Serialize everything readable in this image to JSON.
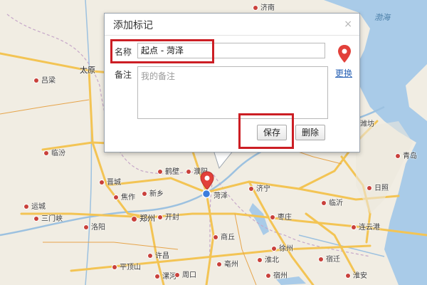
{
  "map": {
    "sea_label": "渤海",
    "cities": [
      {
        "name": "吕梁",
        "major": false
      },
      {
        "name": "太原",
        "major": true
      },
      {
        "name": "临汾",
        "major": false
      },
      {
        "name": "晋城",
        "major": false
      },
      {
        "name": "运城",
        "major": false
      },
      {
        "name": "三门峡",
        "major": false
      },
      {
        "name": "洛阳",
        "major": false
      },
      {
        "name": "郑州",
        "major": true
      },
      {
        "name": "开封",
        "major": false
      },
      {
        "name": "焦作",
        "major": false
      },
      {
        "name": "新乡",
        "major": false
      },
      {
        "name": "鹤壁",
        "major": false
      },
      {
        "name": "濮阳",
        "major": false
      },
      {
        "name": "平顶山",
        "major": false
      },
      {
        "name": "许昌",
        "major": false
      },
      {
        "name": "漯河",
        "major": false
      },
      {
        "name": "周口",
        "major": false
      },
      {
        "name": "商丘",
        "major": false
      },
      {
        "name": "亳州",
        "major": false
      },
      {
        "name": "淮北",
        "major": false
      },
      {
        "name": "宿州",
        "major": false
      },
      {
        "name": "菏泽",
        "major": false
      },
      {
        "name": "济宁",
        "major": false
      },
      {
        "name": "枣庄",
        "major": false
      },
      {
        "name": "徐州",
        "major": false
      },
      {
        "name": "宿迁",
        "major": false
      },
      {
        "name": "淮安",
        "major": false
      },
      {
        "name": "临沂",
        "major": false
      },
      {
        "name": "日照",
        "major": false
      },
      {
        "name": "连云港",
        "major": false
      },
      {
        "name": "青岛",
        "major": false
      },
      {
        "name": "潍坊",
        "major": false
      },
      {
        "name": "济南",
        "major": false
      }
    ]
  },
  "popup": {
    "title": "添加标记",
    "close": "×",
    "name_label": "名称",
    "name_value": "起点 - 菏泽",
    "note_label": "备注",
    "note_placeholder": "我的备注",
    "change_link": "更换",
    "save_button": "保存",
    "delete_button": "删除"
  },
  "colors": {
    "highlight": "#cc1e24",
    "marker": "#e2403a",
    "location_dot": "#3b7ddd"
  }
}
